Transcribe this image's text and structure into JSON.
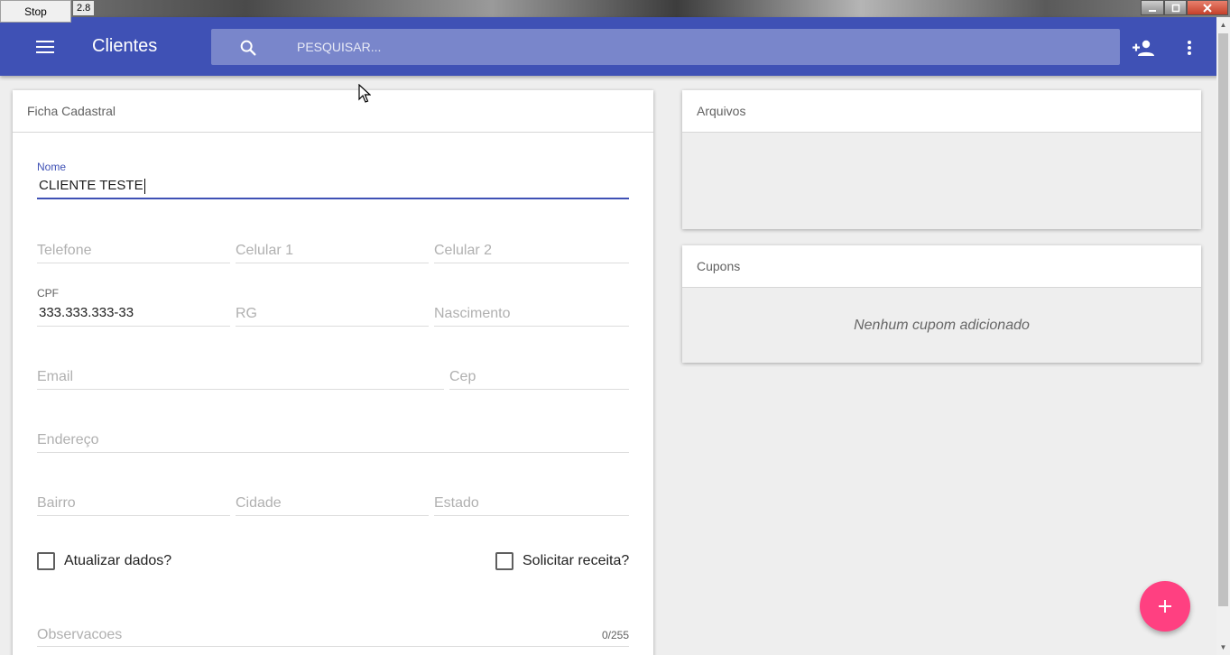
{
  "window": {
    "stop_label": "Stop",
    "version": "2.8"
  },
  "appbar": {
    "title": "Clientes",
    "search_placeholder": "PESQUISAR...",
    "color": "#3f51b5"
  },
  "ficha": {
    "header": "Ficha Cadastral",
    "nome": {
      "label": "Nome",
      "value": "CLIENTE TESTE"
    },
    "telefone": {
      "placeholder": "Telefone"
    },
    "celular1": {
      "placeholder": "Celular 1"
    },
    "celular2": {
      "placeholder": "Celular 2"
    },
    "cpf": {
      "label": "CPF",
      "value": "333.333.333-33"
    },
    "rg": {
      "placeholder": "RG"
    },
    "nascimento": {
      "placeholder": "Nascimento"
    },
    "email": {
      "placeholder": "Email"
    },
    "cep": {
      "placeholder": "Cep"
    },
    "endereco": {
      "placeholder": "Endereço"
    },
    "bairro": {
      "placeholder": "Bairro"
    },
    "cidade": {
      "placeholder": "Cidade"
    },
    "estado": {
      "placeholder": "Estado"
    },
    "atualizar_label": "Atualizar dados?",
    "solicitar_label": "Solicitar receita?",
    "observacoes": {
      "placeholder": "Observacoes",
      "counter": "0/255"
    }
  },
  "arquivos": {
    "header": "Arquivos"
  },
  "cupons": {
    "header": "Cupons",
    "empty_text": "Nenhum cupom adicionado"
  },
  "icons": {
    "menu": "menu-icon",
    "search": "search-icon",
    "add_user": "person-add-icon",
    "more": "more-vert-icon",
    "fab": "add-icon"
  },
  "accent_color": "#ff4081"
}
